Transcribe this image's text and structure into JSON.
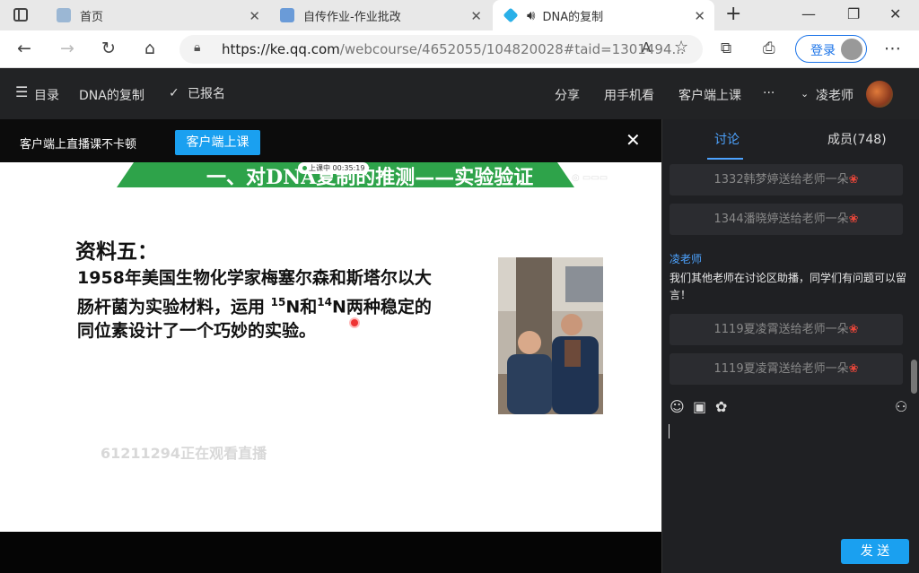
{
  "browser": {
    "tabs": [
      {
        "label": "首页",
        "close": "✕"
      },
      {
        "label": "自传作业-作业批改",
        "close": "✕"
      },
      {
        "label": "DNA的复制",
        "close": "✕"
      }
    ],
    "new_tab": "+",
    "url_main": "https://ke.qq.com",
    "url_rest": "/webcourse/4652055/104820028#taid=1301494...",
    "login_label": "登录"
  },
  "header": {
    "menu_label": "目录",
    "course_title": "DNA的复制",
    "enrolled_label": "已报名",
    "share_label": "分享",
    "mobile_label": "用手机看",
    "client_label": "客户端上课",
    "more_label": "···",
    "teacher_label": "凌老师"
  },
  "notice": {
    "text": "客户端上直播课不卡顿",
    "button": "客户端上课",
    "close": "✕"
  },
  "slide": {
    "banner": "一、对DNA复制的推测——实验验证",
    "live_badge": "上课中 00:35:19",
    "material_title": "资料五：",
    "body_line1": "1958年美国生物化学家梅塞尔森和斯塔尔以大",
    "body_line2a": "肠杆菌为实验材料，运用 ",
    "sup1": "15",
    "body_line2b": "N和",
    "sup2": "14",
    "body_line2c": "N两种稳定的",
    "body_line3": "同位素设计了一个巧妙的实验。",
    "watermark": "61211294正在观看直播"
  },
  "panel": {
    "tab_discuss": "讨论",
    "tab_members": "成员(748)",
    "gifts": [
      {
        "text": "1332韩梦婷送给老师一朵",
        "flower": "❀"
      },
      {
        "text": "1344潘晓婷送给老师一朵",
        "flower": "❀"
      },
      {
        "text": "1119夏凌霄送给老师一朵",
        "flower": "❀"
      },
      {
        "text": "1119夏凌霄送给老师一朵",
        "flower": "❀"
      }
    ],
    "teacher_name": "凌老师",
    "teacher_msg": "我们其他老师在讨论区助播，同学们有问题可以留言！",
    "send_label": "发 送"
  },
  "icons": {
    "emoji": "☺",
    "image": "▣",
    "flower": "✿",
    "person": "⚇"
  }
}
